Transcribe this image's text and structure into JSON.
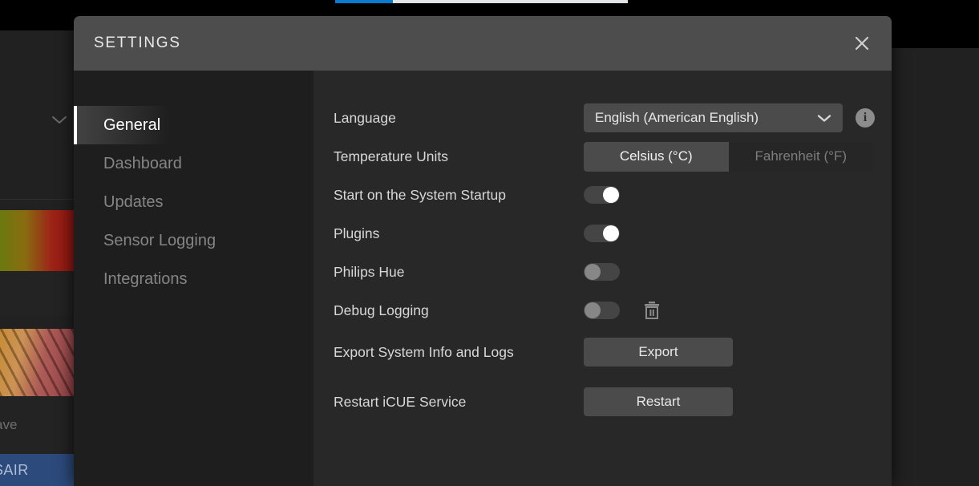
{
  "background": {
    "chevron_icon": "chevron-down-icon",
    "save_text": "ave",
    "brand_text": "SAIR",
    "progress_percent": 20
  },
  "modal": {
    "title": "SETTINGS",
    "close_icon": "close-icon"
  },
  "sidebar": {
    "items": [
      {
        "label": "General",
        "active": true
      },
      {
        "label": "Dashboard",
        "active": false
      },
      {
        "label": "Updates",
        "active": false
      },
      {
        "label": "Sensor Logging",
        "active": false
      },
      {
        "label": "Integrations",
        "active": false
      }
    ]
  },
  "settings": {
    "language": {
      "label": "Language",
      "value": "English (American English)",
      "chevron_icon": "chevron-down-icon",
      "info_icon": "info-icon",
      "info_glyph": "i"
    },
    "temperature_units": {
      "label": "Temperature Units",
      "options": [
        "Celsius (°C)",
        "Fahrenheit (°F)"
      ],
      "selected": "Celsius (°C)"
    },
    "toggles": [
      {
        "label": "Start on the System Startup",
        "state": "on",
        "has_trash": false
      },
      {
        "label": "Plugins",
        "state": "on",
        "has_trash": false
      },
      {
        "label": "Philips Hue",
        "state": "off",
        "has_trash": false
      },
      {
        "label": "Debug Logging",
        "state": "off",
        "has_trash": true,
        "trash_icon": "trash-icon"
      }
    ],
    "actions": [
      {
        "label": "Export System Info and Logs",
        "button": "Export"
      },
      {
        "label": "Restart iCUE Service",
        "button": "Restart"
      }
    ]
  },
  "colors": {
    "modal_header": "#4d4d4d",
    "sidebar_bg": "#1e1e1e",
    "content_bg": "#282828",
    "control_bg": "#4b4b4b",
    "accent_active": "#ffffff",
    "brand_blue": "#2c4a7c",
    "progress_blue": "#0a7fd4"
  }
}
